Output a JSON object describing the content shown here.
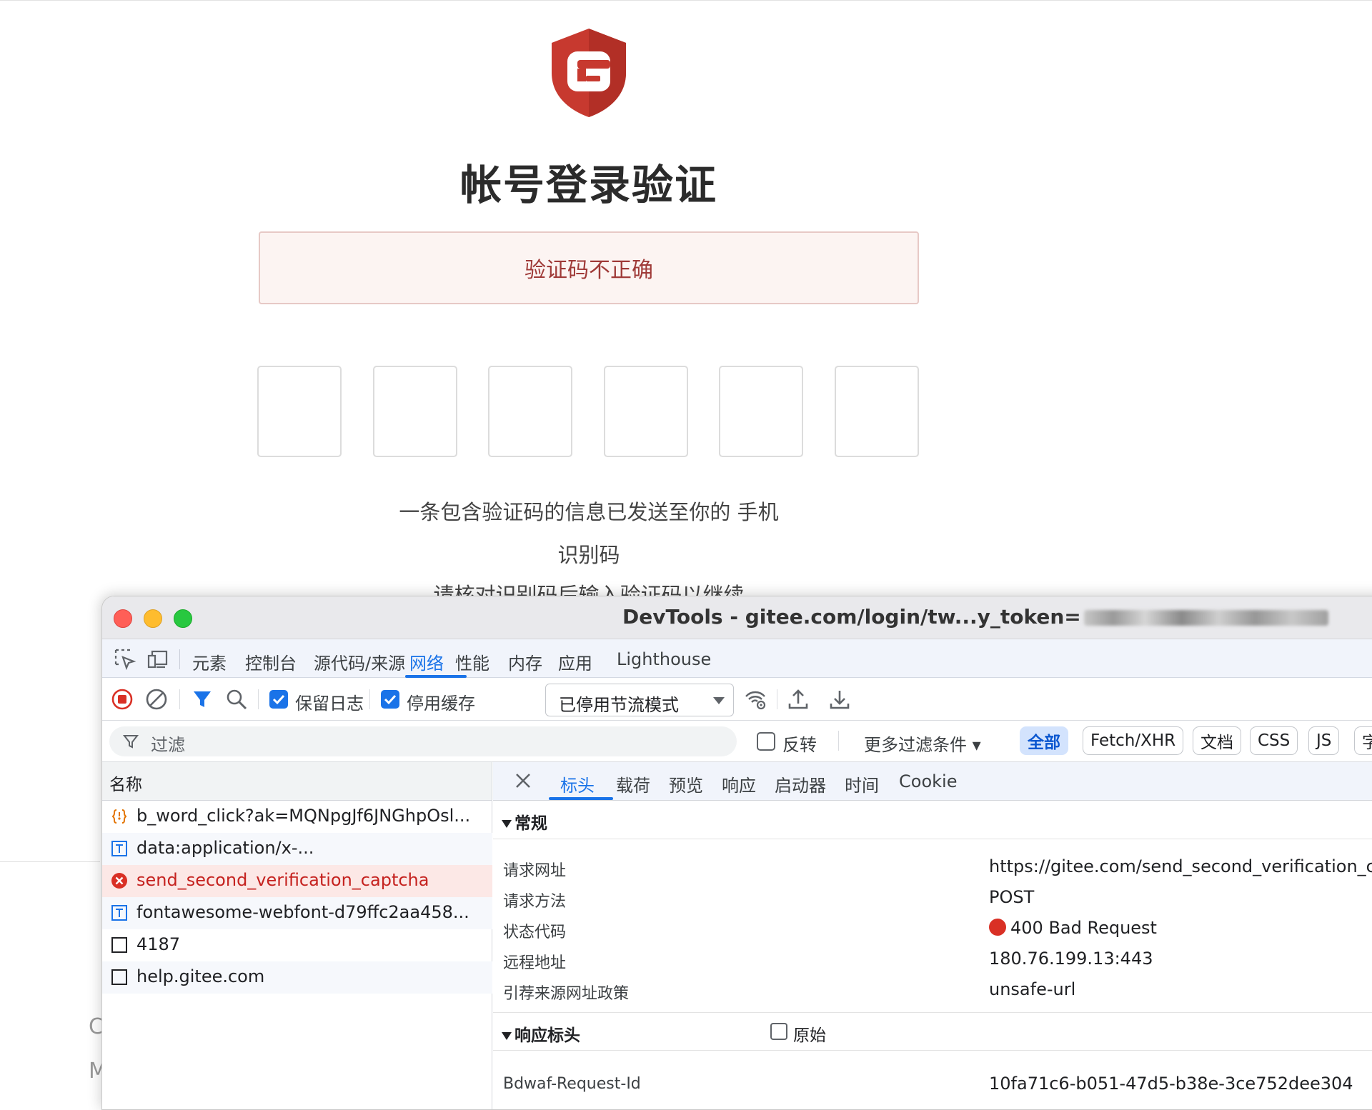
{
  "page": {
    "heading": "帐号登录验证",
    "alert": "验证码不正确",
    "code_boxes": [
      "",
      "",
      "",
      "",
      "",
      ""
    ],
    "info_line1": "一条包含验证码的信息已发送至你的 手机",
    "info_line2": "识别码",
    "info_line3": "请核对识别码后输入验证码以继续",
    "cut_text1": "C",
    "cut_text2": "M"
  },
  "devtools": {
    "window_title": "DevTools - gitee.com/login/tw...y_token=",
    "tabs": [
      "元素",
      "控制台",
      "源代码/来源",
      "网络",
      "性能",
      "内存",
      "应用",
      "Lighthouse"
    ],
    "active_tab": "网络",
    "toolbar": {
      "preserve_log_label": "保留日志",
      "preserve_log_checked": true,
      "disable_cache_label": "停用缓存",
      "disable_cache_checked": true,
      "throttle_value": "已停用节流模式"
    },
    "filter": {
      "placeholder": "过滤",
      "invert_label": "反转",
      "more_filters_label": "更多过滤条件 ▾",
      "chips": [
        "全部",
        "Fetch/XHR",
        "文档",
        "CSS",
        "JS",
        "字"
      ],
      "active_chip": "全部"
    },
    "request_list": {
      "header": "名称",
      "rows": [
        {
          "name": "b_word_click?ak=MQNpgJf6JNGhpOsl...",
          "icon": "script-icon"
        },
        {
          "name": "data:application/x-...",
          "icon": "text-doc-icon"
        },
        {
          "name": "send_second_verification_captcha",
          "icon": "error-icon",
          "selected": true
        },
        {
          "name": "fontawesome-webfont-d79ffc2aa458...",
          "icon": "text-doc-icon"
        },
        {
          "name": "4187",
          "icon": "blank-doc-icon"
        },
        {
          "name": "help.gitee.com",
          "icon": "blank-doc-icon"
        }
      ]
    },
    "details": {
      "tabs": [
        "标头",
        "载荷",
        "预览",
        "响应",
        "启动器",
        "时间",
        "Cookie"
      ],
      "active_tab": "标头",
      "general_title": "常规",
      "general": [
        {
          "key": "请求网址",
          "value": "https://gitee.com/send_second_verification_captcha"
        },
        {
          "key": "请求方法",
          "value": "POST"
        },
        {
          "key": "状态代码",
          "value": "400 Bad Request"
        },
        {
          "key": "远程地址",
          "value": "180.76.199.13:443"
        },
        {
          "key": "引荐来源网址政策",
          "value": "unsafe-url"
        }
      ],
      "response_headers_title": "响应标头",
      "raw_label": "原始",
      "response_headers": [
        {
          "key": "Bdwaf-Request-Id",
          "value": "10fa71c6-b051-47d5-b38e-3ce752dee304"
        }
      ]
    },
    "colors": {
      "accent": "#1a73e8",
      "error": "#d93025",
      "brand": "#c7392f"
    }
  }
}
